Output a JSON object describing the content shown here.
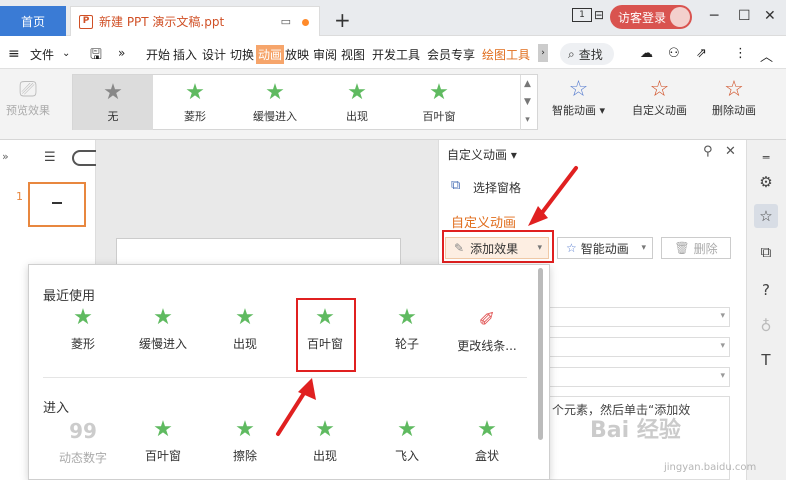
{
  "titlebar": {
    "home_tab": "首页",
    "doc_icon": "P",
    "doc_title": "新建 PPT 演示文稿.ppt",
    "new_tab_icon": "+",
    "page_indicator": "1",
    "login_label": "访客登录",
    "accent": "#d05026"
  },
  "menubar": {
    "file_label": "文件",
    "tabs": [
      "开始",
      "插入",
      "设计",
      "切换",
      "动画",
      "放映",
      "审阅",
      "视图",
      "开发工具",
      "会员专享",
      "绘图工具"
    ],
    "search_label": "查找"
  },
  "ribbon": {
    "preview_label": "预览效果",
    "gallery": [
      "无",
      "菱形",
      "缓慢进入",
      "出现",
      "百叶窗"
    ],
    "smart_anim_label": "智能动画",
    "custom_anim_label": "自定义动画",
    "delete_anim_label": "删除动画"
  },
  "slides_panel": {
    "slide_number": "1"
  },
  "custom_panel": {
    "header": "自定义动画",
    "selection_pane": "选择窗格",
    "section_title": "自定义动画",
    "add_effect": "添加效果",
    "smart_anim": "智能动画",
    "delete": "删除",
    "hint_text": "个元素，然后单击“添加效"
  },
  "effects_dropdown": {
    "recent_title": "最近使用",
    "recent": [
      "菱形",
      "缓慢进入",
      "出现",
      "百叶窗",
      "轮子",
      "更改线条..."
    ],
    "enter_title": "进入",
    "enter": [
      "动态数字",
      "百叶窗",
      "擦除",
      "出现",
      "飞入",
      "盒状"
    ]
  },
  "watermark": {
    "text": "Bai 经验",
    "sub": "jingyan.baidu.com"
  }
}
